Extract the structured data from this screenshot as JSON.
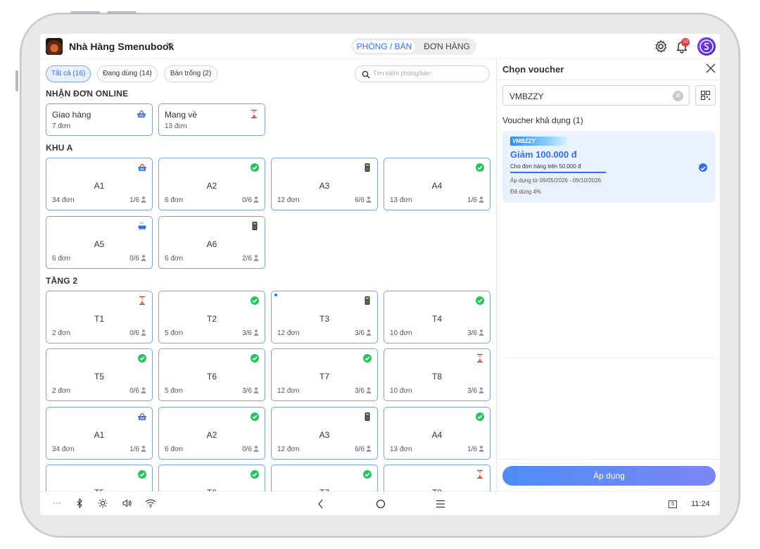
{
  "header": {
    "restaurant_name": "Nhà Hàng Smenubook",
    "tabs": [
      "PHÒNG / BÀN",
      "ĐƠN HÀNG"
    ],
    "active_tab": "PHÒNG / BÀN",
    "notification_count": "10"
  },
  "filters": {
    "chips": [
      "Tất cả (16)",
      "Đang dùng (14)",
      "Bàn trống (2)"
    ],
    "active": "Tất cả (16)",
    "search_placeholder": "Tìm kiếm phòng/bàn"
  },
  "sections": {
    "online": {
      "title": "NHẬN ĐƠN ONLINE",
      "items": [
        {
          "name": "Giao hàng",
          "orders": "7 đơn",
          "icon": "basket-icon"
        },
        {
          "name": "Mang về",
          "orders": "13 đơn",
          "icon": "hourglass-icon"
        }
      ]
    },
    "khu_a": {
      "title": "KHU A",
      "tables": [
        {
          "name": "A1",
          "orders": "34 đơn",
          "seats": "1/6",
          "icon": "basket-icon"
        },
        {
          "name": "A2",
          "orders": "6 đơn",
          "seats": "0/6",
          "icon": "check-circle-icon"
        },
        {
          "name": "A3",
          "orders": "12 đơn",
          "seats": "6/6",
          "icon": "pos-terminal-icon"
        },
        {
          "name": "A4",
          "orders": "13 đơn",
          "seats": "1/6",
          "icon": "check-circle-icon"
        },
        {
          "name": "A5",
          "orders": "6 đơn",
          "seats": "0/6",
          "icon": "bathtub-icon"
        },
        {
          "name": "A6",
          "orders": "6 đơn",
          "seats": "2/6",
          "icon": "pos-terminal-icon"
        }
      ]
    },
    "tang_2": {
      "title": "TẦNG 2",
      "tables": [
        {
          "name": "T1",
          "orders": "2 đơn",
          "seats": "0/6",
          "icon": "hourglass-icon"
        },
        {
          "name": "T2",
          "orders": "5 đơn",
          "seats": "3/6",
          "icon": "check-circle-icon"
        },
        {
          "name": "T3",
          "orders": "12 đơn",
          "seats": "3/6",
          "icon": "pos-terminal-icon"
        },
        {
          "name": "T4",
          "orders": "10 đơn",
          "seats": "3/6",
          "icon": "check-circle-icon"
        },
        {
          "name": "T5",
          "orders": "2 đơn",
          "seats": "0/6",
          "icon": "check-circle-icon"
        },
        {
          "name": "T6",
          "orders": "5 đơn",
          "seats": "3/6",
          "icon": "check-circle-icon"
        },
        {
          "name": "T7",
          "orders": "12 đơn",
          "seats": "3/6",
          "icon": "check-circle-icon"
        },
        {
          "name": "T8",
          "orders": "10 đơn",
          "seats": "3/6",
          "icon": "hourglass-icon"
        },
        {
          "name": "A1",
          "orders": "34 đơn",
          "seats": "1/6",
          "icon": "basket-icon"
        },
        {
          "name": "A2",
          "orders": "6 đơn",
          "seats": "0/6",
          "icon": "check-circle-icon"
        },
        {
          "name": "A3",
          "orders": "12 đơn",
          "seats": "6/6",
          "icon": "pos-terminal-icon"
        },
        {
          "name": "A4",
          "orders": "13 đơn",
          "seats": "1/6",
          "icon": "check-circle-icon"
        },
        {
          "name": "T5",
          "orders": "",
          "seats": "",
          "icon": "check-circle-icon"
        },
        {
          "name": "T6",
          "orders": "",
          "seats": "",
          "icon": "check-circle-icon"
        },
        {
          "name": "T7",
          "orders": "",
          "seats": "",
          "icon": "check-circle-icon"
        },
        {
          "name": "T8",
          "orders": "",
          "seats": "",
          "icon": "hourglass-icon"
        }
      ]
    }
  },
  "voucher_panel": {
    "title": "Chọn voucher",
    "input_value": "VMBZZY",
    "available_label": "Voucher khả dụng (1)",
    "voucher": {
      "code": "VMBZZY",
      "title": "Giảm 100.000 đ",
      "condition": "Cho đơn hàng trên 50.000 đ",
      "valid_dates": "Áp dụng từ 09/05/2026 - 09/10/2026",
      "usage": "Đã dùng 4%",
      "usage_percent": 4,
      "selected": true
    },
    "apply_label": "Áp dụng"
  },
  "system_bar": {
    "time": "11:24",
    "screen_count": "5"
  },
  "colors": {
    "accent": "#2f6ff0",
    "card_border": "#7da0df",
    "success": "#22c55e",
    "badge": "#e53935"
  }
}
